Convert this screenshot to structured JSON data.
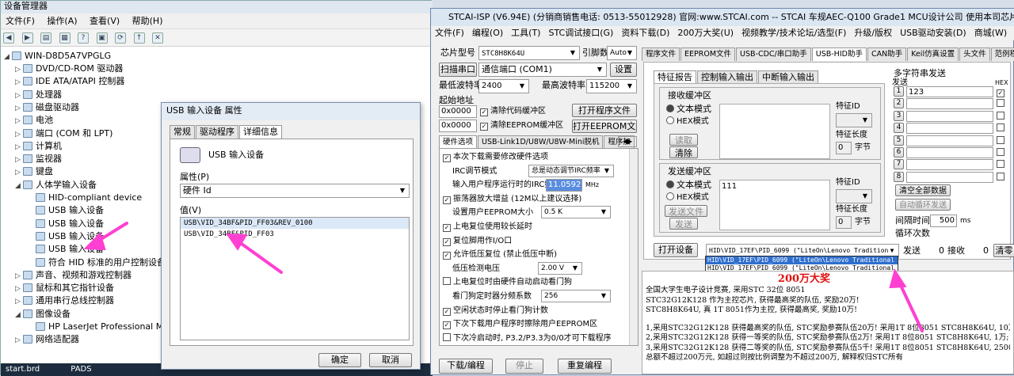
{
  "dm": {
    "title": "设备管理器",
    "menu": [
      "文件(F)",
      "操作(A)",
      "查看(V)",
      "帮助(H)"
    ],
    "root": "WIN-D8D5A7VPGLG",
    "nodes": [
      {
        "label": "DVD/CD-ROM 驱动器",
        "depth": 1
      },
      {
        "label": "IDE ATA/ATAPI 控制器",
        "depth": 1
      },
      {
        "label": "处理器",
        "depth": 1
      },
      {
        "label": "磁盘驱动器",
        "depth": 1
      },
      {
        "label": "电池",
        "depth": 1
      },
      {
        "label": "端口 (COM 和 LPT)",
        "depth": 1
      },
      {
        "label": "计算机",
        "depth": 1
      },
      {
        "label": "监视器",
        "depth": 1
      },
      {
        "label": "键盘",
        "depth": 1
      },
      {
        "label": "人体学输入设备",
        "depth": 1
      },
      {
        "label": "HID-compliant device",
        "depth": 2
      },
      {
        "label": "USB 输入设备",
        "depth": 2
      },
      {
        "label": "USB 输入设备",
        "depth": 2
      },
      {
        "label": "USB 输入设备",
        "depth": 2
      },
      {
        "label": "USB 输入设备",
        "depth": 2
      },
      {
        "label": "符合 HID 标准的用户控制设备",
        "depth": 2
      },
      {
        "label": "声音、视频和游戏控制器",
        "depth": 1
      },
      {
        "label": "鼠标和其它指针设备",
        "depth": 1
      },
      {
        "label": "通用串行总线控制器",
        "depth": 1
      },
      {
        "label": "图像设备",
        "depth": 1
      },
      {
        "label": "HP LaserJet Professional M121",
        "depth": 2
      },
      {
        "label": "网络适配器",
        "depth": 1
      }
    ],
    "taskbar": [
      "start.brd",
      "PADS"
    ]
  },
  "dlg": {
    "title": "USB 输入设备 属性",
    "tabs": [
      "常规",
      "驱动程序",
      "详细信息"
    ],
    "device_name": "USB 输入设备",
    "property_label": "属性(P)",
    "property_value": "硬件 Id",
    "value_label": "值(V)",
    "values": [
      "USB\\VID_34BF&PID_FF03&REV_0100",
      "USB\\VID_34BF&PID_FF03"
    ],
    "ok": "确定",
    "cancel": "取消"
  },
  "stc": {
    "title": "STCAI-ISP (V6.94E) (分销商销售电话: 0513-55012928) 官网:www.STCAI.com  -- STCAI 车规AEC-Q100 Grade1 MCU设计公司 使用本司芯片或采...",
    "menu": [
      "文件(F)",
      "编程(O)",
      "工具(T)",
      "STC调试接口(G)",
      "资料下载(D)",
      "200万大奖(U)",
      "视频教学/技术论坛/选型(F)",
      "升级/版权",
      "USB驱动安装(D)",
      "商城(W)",
      "界面(L)",
      "Englis"
    ],
    "chip_label": "芯片型号",
    "chip": "STC8H8K64U",
    "pin_label": "引脚数",
    "pin": "Auto",
    "scan": "扫描串口",
    "port": "通信端口 (COM1)",
    "settings": "设置",
    "min_baud_label": "最低波特率",
    "min_baud": "2400",
    "max_baud_label": "最高波特率",
    "max_baud": "115200",
    "start_addr": "起始地址",
    "addr1": "0x0000",
    "addr2": "0x0000",
    "clear_code": "清除代码缓冲区",
    "clear_eeprom": "清除EEPROM缓冲区",
    "open_prog": "打开程序文件",
    "open_eeprom": "打开EEPROM文件",
    "opt_tabs": [
      "硬件选项",
      "USB-Link1D/U8W/U8W-Mini脱机",
      "程序加"
    ],
    "options": [
      {
        "label": "本次下载需要修改硬件选项",
        "checked": true
      },
      {
        "label": "IRC调节模式",
        "combo": "总是动态调节IRC频率"
      },
      {
        "label": "输入用户程序运行时的IRC频率",
        "input": "11.0592",
        "unit": "MHz"
      },
      {
        "label": "振荡器放大增益 (12M以上建议选择)",
        "checked": true
      },
      {
        "label": "设置用户EEPROM大小",
        "combo": "0.5 K"
      },
      {
        "label": "上电复位使用较长延时",
        "checked": true
      },
      {
        "label": "复位脚用作I/O口",
        "checked": true
      },
      {
        "label": "允许低压复位 (禁止低压中断)",
        "checked": true
      },
      {
        "label": "低压检测电压",
        "combo": "2.00 V"
      },
      {
        "label": "上电复位时由硬件自动启动看门狗",
        "checked": false
      },
      {
        "label": "看门狗定时器分频系数",
        "combo": "256"
      },
      {
        "label": "空闲状态时停止看门狗计数",
        "checked": true
      },
      {
        "label": "下次下载用户程序时擦除用户EEPROM区",
        "checked": true
      },
      {
        "label": "下次冷启动时, P3.2/P3.3为0/0才可下载程序",
        "checked": false
      }
    ],
    "download": "下载/编程",
    "stop": "停止",
    "reprogram": "重复编程",
    "right_tabs": [
      "程序文件",
      "EEPROM文件",
      "USB-CDC/串口助手",
      "USB-HID助手",
      "CAN助手",
      "Keil仿真设置",
      "头文件",
      "范例程序"
    ],
    "hid_tabs": [
      "特征报告",
      "控制输入输出",
      "中断输入输出"
    ],
    "recv_title": "接收缓冲区",
    "send_title": "发送缓冲区",
    "text_mode": "文本模式",
    "hex_mode": "HEX模式",
    "read": "读取",
    "clear": "清除",
    "send_file": "发送文件",
    "send": "发送",
    "feature_id": "特征ID",
    "feature_len": "特征长度",
    "len_val": "0",
    "bytes": "字节",
    "send_text": "111",
    "multi_title": "多字符串发送",
    "multi_send": "发送",
    "multi_hex": "HEX",
    "multi_rows": [
      "1",
      "2",
      "3",
      "4",
      "5",
      "6",
      "7",
      "8"
    ],
    "multi_first": "123",
    "clear_all": "清空全部数据",
    "auto_loop": "自动循环发送",
    "interval_label": "间隔时间",
    "interval": "500",
    "interval_unit": "ms",
    "loop_label": "循环次数",
    "open_dev": "打开设备",
    "hid_sel": "HID\\VID_17EF\\PID_6099 (\"LiteOn\\Lenovo Tradition",
    "hid_opts": [
      "HID\\VID_17EF\\PID_6099 (\"LiteOn\\Lenovo Traditional",
      "HID\\VID_17EF\\PID_6099 (\"LiteOn\\Lenovo Traditional"
    ],
    "sent_label": "发送",
    "sent": "0",
    "recv_label": "接收",
    "recv": "0",
    "clear_btn": "清零",
    "prize": "200万大奖",
    "out_lines": [
      "全国大学生电子设计竞赛, 采用STC 32位 8051",
      "STC32G12K128 作为主控芯片, 获得最高奖的队伍, 奖励20万!",
      "STC8H8K64U, 真 1T 8051作为主控, 获得最高奖, 奖励10万!",
      "",
      "1,采用STC32G12K128 获得最高奖的队伍, STC奖励参赛队伍20万! 采用1T 8位8051 STC8H8K64U, 10万;",
      "2,采用STC32G12K128 获得一等奖的队伍, STC奖励参赛队伍2万! 采用1T 8位8051 STC8H8K64U, 1万;",
      "3,采用STC32G12K128 获得二等奖的队伍, STC奖励参赛队伍5千! 采用1T 8位8051 STC8H8K64U, 2500元;",
      "总额不超过200万元, 如超过则按比例调整为不超过200万, 解释权归STC所有"
    ]
  }
}
